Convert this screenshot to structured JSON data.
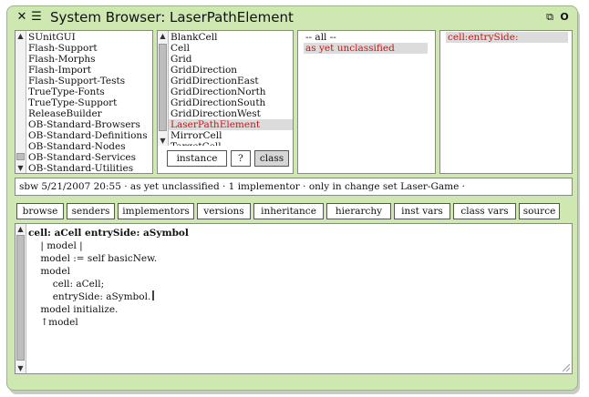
{
  "window": {
    "title": "System Browser: LaserPathElement",
    "close_glyph": "✕",
    "menu_glyph": "☰",
    "collapse_glyph": "⧉",
    "expand_glyph": "O"
  },
  "packages": {
    "items": [
      "SUnitGUI",
      "Flash-Support",
      "Flash-Morphs",
      "Flash-Import",
      "Flash-Support-Tests",
      "TrueType-Fonts",
      "TrueType-Support",
      "ReleaseBuilder",
      "OB-Standard-Browsers",
      "OB-Standard-Definitions",
      "OB-Standard-Nodes",
      "OB-Standard-Services",
      "OB-Standard-Utilities"
    ]
  },
  "classes": {
    "items": [
      "BlankCell",
      "Cell",
      "Grid",
      "GridDirection",
      "GridDirectionEast",
      "GridDirectionNorth",
      "GridDirectionSouth",
      "GridDirectionWest",
      "LaserPathElement",
      "MirrorCell",
      "TargetCell"
    ],
    "selected": "LaserPathElement",
    "mode_buttons": {
      "instance": "instance",
      "help": "?",
      "class": "class"
    }
  },
  "categories": {
    "items": [
      "-- all --",
      "as yet unclassified"
    ],
    "selected": "as yet unclassified"
  },
  "methods": {
    "items": [
      "cell:entrySide:"
    ],
    "selected": "cell:entrySide:"
  },
  "info_line": "sbw 5/21/2007 20:55 · as yet unclassified · 1 implementor · only in change set Laser-Game  ·",
  "toolbar": {
    "browse": "browse",
    "senders": "senders",
    "implementors": "implementors",
    "versions": "versions",
    "inheritance": "inheritance",
    "hierarchy": "hierarchy",
    "inst_vars": "inst vars",
    "class_vars": "class vars",
    "source": "source"
  },
  "code": {
    "signature": "cell: aCell entrySide: aSymbol",
    "lines": [
      "    | model |",
      "    model := self basicNew.",
      "    model",
      "        cell: aCell;",
      "        entrySide: aSymbol.",
      "    model initialize.",
      "    ↑model"
    ]
  },
  "colors": {
    "window_bg": "#cfe8b2",
    "selection_text": "#c01818",
    "selection_bg": "#dcdcdc"
  }
}
